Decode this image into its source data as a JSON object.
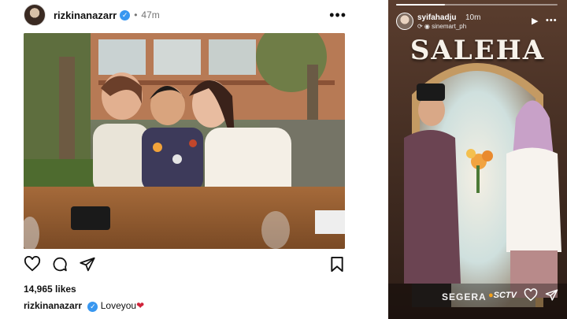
{
  "post": {
    "username": "rizkinanazarr",
    "separator": "•",
    "time": "47m",
    "more": "•••",
    "likes": "14,965 likes",
    "caption_user": "rizkinanazarr",
    "caption_text": "Loveyou",
    "caption_emoji": "❤"
  },
  "story": {
    "progress": 0.3,
    "username": "syifahadju",
    "time": "10m",
    "sub_label": "sinemart_ph",
    "title": "SALEHA",
    "segera": "SEGERA",
    "channel": "SCTV"
  },
  "colors": {
    "verified": "#3897f0",
    "heart": "#d0233a",
    "story_bg": "#3b2a22"
  }
}
